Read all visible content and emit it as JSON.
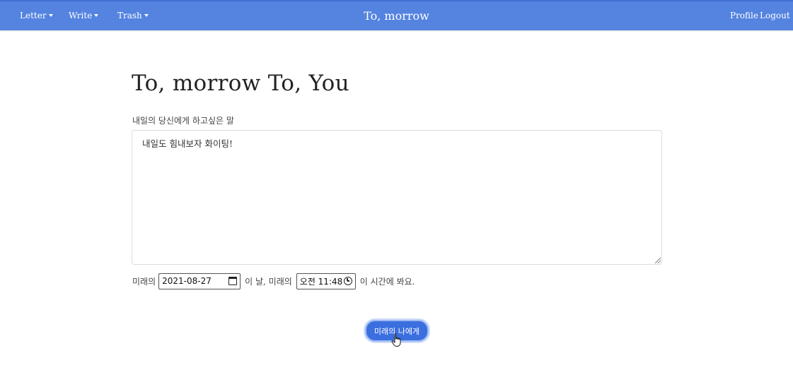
{
  "navbar": {
    "brand": "To, morrow",
    "left_menu": [
      {
        "label": "Letter"
      },
      {
        "label": "Write"
      },
      {
        "label": "Trash"
      }
    ],
    "right_links": {
      "profile": "Profile",
      "logout": "Logout"
    },
    "color": "#5483e0"
  },
  "main": {
    "title": "To, morrow To, You",
    "message_label": "내일의 당신에게 하고싶은 말",
    "message_value": "내일도 힘내보자 화이팅!",
    "schedule": {
      "prefix": "미래의",
      "date_value": "2021-08-27",
      "middle": "이 날, 미래의",
      "time_value": "오전 11:48",
      "suffix": "이 시간에 봐요."
    },
    "submit_label": "미래의 나에게",
    "button_color": "#3b6fe0"
  }
}
